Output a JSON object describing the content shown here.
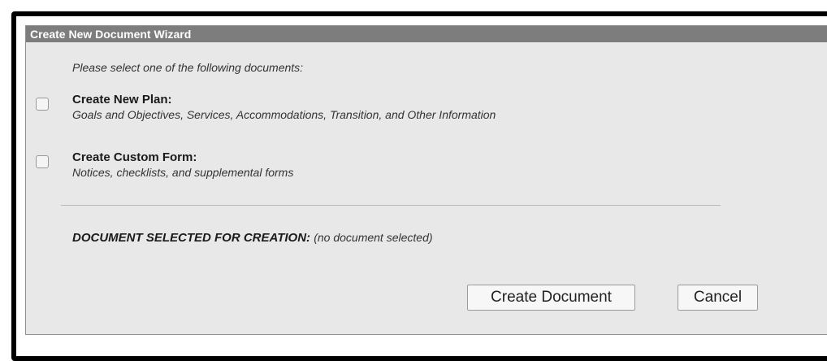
{
  "dialog": {
    "title": "Create New Document Wizard",
    "instruction": "Please select one of the following documents:",
    "options": [
      {
        "title": "Create New Plan:",
        "description": "Goals and Objectives, Services, Accommodations, Transition, and Other Information",
        "checked": false
      },
      {
        "title": "Create Custom Form:",
        "description": "Notices, checklists, and supplemental forms",
        "checked": false
      }
    ],
    "selection": {
      "label": "DOCUMENT SELECTED FOR CREATION:",
      "value": "(no document selected)"
    },
    "buttons": {
      "create": "Create Document",
      "cancel": "Cancel"
    }
  },
  "colors": {
    "titlebar": "#7d7d7d",
    "dialog_bg": "#e8e8e8",
    "outer_border": "#000000"
  }
}
